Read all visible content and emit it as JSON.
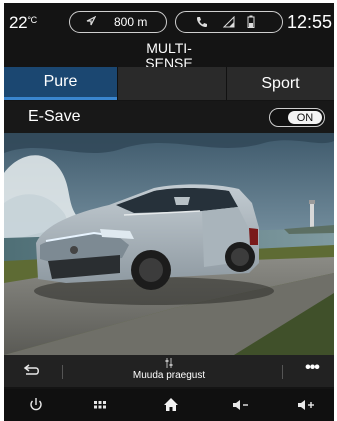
{
  "status": {
    "temperature": "22",
    "temperature_unit": "°C",
    "nav_distance": "800 m",
    "clock": "12:55"
  },
  "title": {
    "line1": "MULTI-",
    "line2": "SENSE"
  },
  "modes": [
    {
      "label": "Pure",
      "selected": true
    },
    {
      "label": "",
      "selected": false
    },
    {
      "label": "Sport",
      "selected": false
    }
  ],
  "esave": {
    "label": "E-Save",
    "toggle_state": "ON"
  },
  "photo": {
    "subject": "suv-car-icon"
  },
  "actionbar": {
    "adjust_label": "Muuda praegust",
    "more_label": "•••"
  },
  "bottom_nav": [
    "power-icon",
    "apps-grid-icon",
    "home-icon",
    "volume-down-icon",
    "volume-up-icon"
  ],
  "colors": {
    "accent": "#3a86cf",
    "selected_mode_bg": "#1b4771",
    "background": "#141414"
  }
}
